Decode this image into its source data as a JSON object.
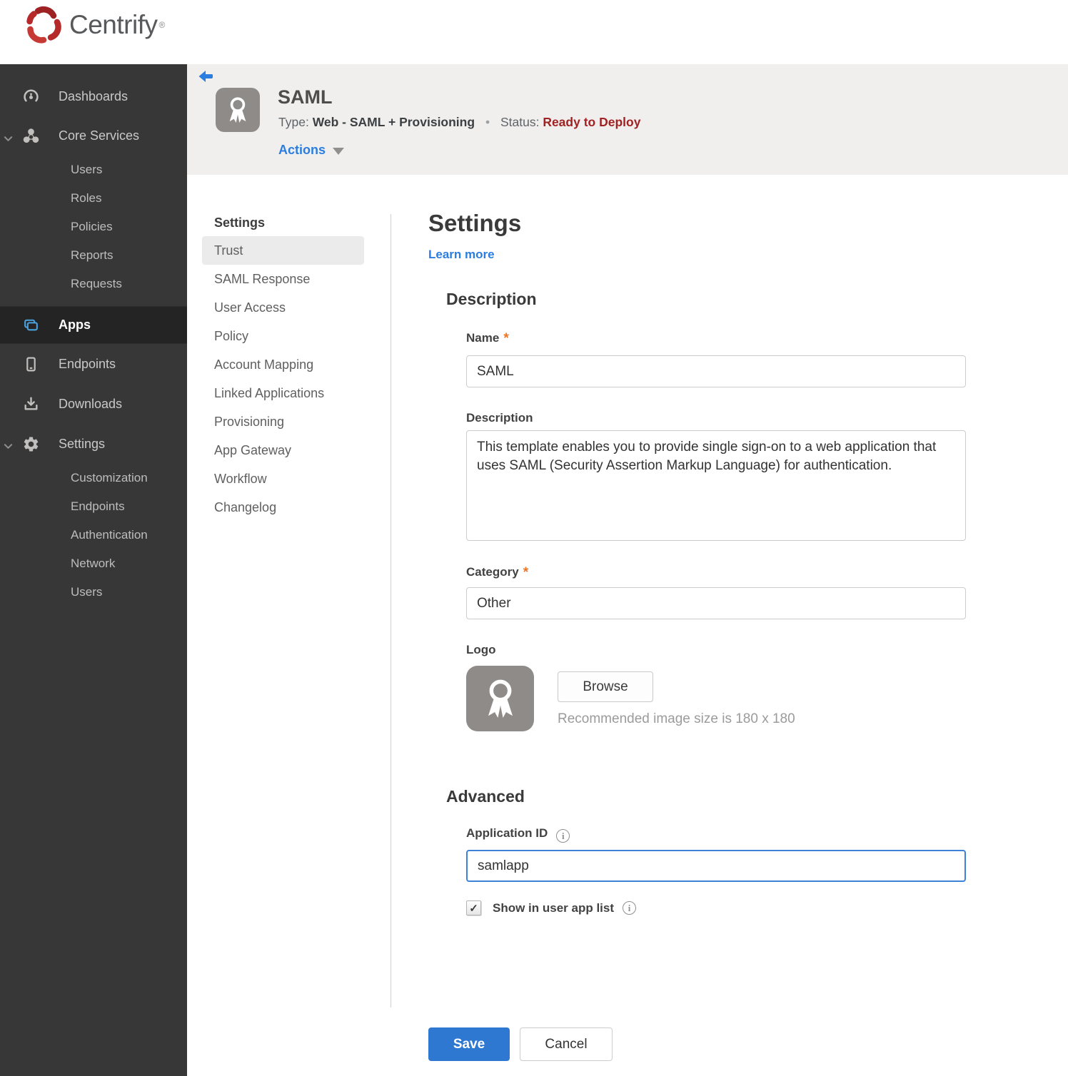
{
  "brand": {
    "name": "Centrify",
    "trademark": "®"
  },
  "colors": {
    "accent_blue": "#2b7de0",
    "save_button_blue": "#2e78d2",
    "status_red": "#a02222",
    "required_orange": "#ed7524",
    "sidebar_bg": "#373737",
    "sidebar_active_bg": "#242424",
    "apps_icon_blue": "#4aa3df",
    "header_band_bg": "#f0efee",
    "subnav_selected_bg": "#ebebeb",
    "logo_red": "#b5292a"
  },
  "icons": {
    "info_glyph": "i",
    "check_glyph": "✓",
    "required_marker": "*",
    "meta_dot": "•"
  },
  "sidebar": {
    "items": [
      {
        "label": "Dashboards",
        "icon": "gauge-icon"
      },
      {
        "label": "Core Services",
        "icon": "core-services-icon",
        "expanded": true,
        "children": [
          "Users",
          "Roles",
          "Policies",
          "Reports",
          "Requests"
        ]
      },
      {
        "label": "Apps",
        "icon": "apps-icon",
        "active": true
      },
      {
        "label": "Endpoints",
        "icon": "mobile-icon"
      },
      {
        "label": "Downloads",
        "icon": "download-icon"
      },
      {
        "label": "Settings",
        "icon": "gear-icon",
        "expanded": true,
        "children": [
          "Customization",
          "Endpoints",
          "Authentication",
          "Network",
          "Users"
        ]
      }
    ]
  },
  "header": {
    "app_title": "SAML",
    "type_label": "Type:",
    "type_value": "Web - SAML + Provisioning",
    "status_label": "Status:",
    "status_value": "Ready to Deploy",
    "actions_label": "Actions"
  },
  "subnav": {
    "header": "Settings",
    "selected": "Trust",
    "items": [
      "Trust",
      "SAML Response",
      "User Access",
      "Policy",
      "Account Mapping",
      "Linked Applications",
      "Provisioning",
      "App Gateway",
      "Workflow",
      "Changelog"
    ]
  },
  "main": {
    "title": "Settings",
    "learn_more": "Learn more",
    "description_section": {
      "heading": "Description",
      "name_label": "Name",
      "name_value": "SAML",
      "description_label": "Description",
      "description_value": "This template enables you to provide single sign-on to a web application that uses SAML (Security Assertion Markup Language) for authentication.",
      "category_label": "Category",
      "category_value": "Other",
      "logo_label": "Logo",
      "browse_label": "Browse",
      "logo_hint": "Recommended image size is 180 x 180"
    },
    "advanced_section": {
      "heading": "Advanced",
      "application_id_label": "Application ID",
      "application_id_value": "samlapp",
      "show_in_app_list_label": "Show in user app list",
      "checkbox_checked": true
    },
    "buttons": {
      "save": "Save",
      "cancel": "Cancel"
    }
  }
}
